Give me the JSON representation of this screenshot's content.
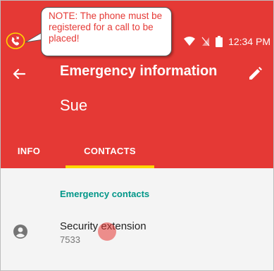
{
  "annotation": {
    "note": "NOTE: The phone must be registered for a call to be placed!"
  },
  "status_bar": {
    "time": "12:34 PM",
    "icons": [
      "call-icon",
      "wifi-icon",
      "no-sim-icon",
      "battery-icon"
    ]
  },
  "toolbar": {
    "title": "Emergency information",
    "back_icon": "arrow-back-icon",
    "edit_icon": "pencil-icon"
  },
  "profile": {
    "name": "Sue"
  },
  "tabs": [
    {
      "label": "INFO",
      "selected": false
    },
    {
      "label": "CONTACTS",
      "selected": true
    }
  ],
  "contacts": {
    "section_title": "Emergency contacts",
    "items": [
      {
        "name": "Security extension",
        "number": "7533",
        "icon": "account-circle-icon"
      }
    ]
  },
  "colors": {
    "header": "#e53935",
    "tab_indicator": "#ffd600",
    "section_title": "#009688",
    "annotation_text": "#e53935"
  }
}
